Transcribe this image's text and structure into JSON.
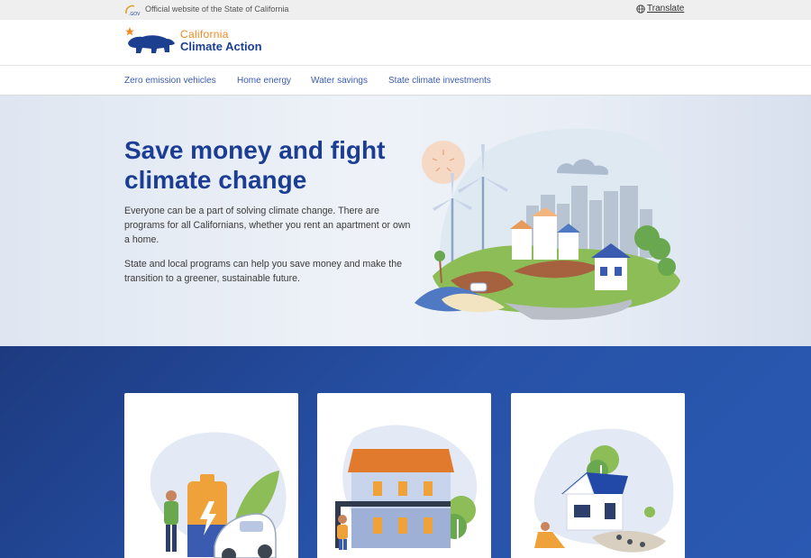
{
  "util_bar": {
    "official_text": "Official website of the State of California",
    "translate_label": "Translate"
  },
  "brand": {
    "logo_line1": "California",
    "logo_line2": "Climate Action"
  },
  "nav": {
    "items": [
      {
        "label": "Zero emission vehicles"
      },
      {
        "label": "Home energy"
      },
      {
        "label": "Water savings"
      },
      {
        "label": "State climate investments"
      }
    ]
  },
  "hero": {
    "title": "Save money and fight climate change",
    "paragraph1": "Everyone can be a part of solving climate change. There are programs for all Californians, whether you rent an apartment or own a home.",
    "paragraph2": "State and local programs can help you save money and make the transition to a greener, sustainable future."
  },
  "colors": {
    "brand_blue": "#1b3d94",
    "brand_orange": "#f08a24",
    "nav_link": "#3b5bb0",
    "section_blue": "#2752a8"
  },
  "cards": [
    {
      "icon": "ev-battery-illustration"
    },
    {
      "icon": "apartment-building-illustration"
    },
    {
      "icon": "house-illustration"
    }
  ]
}
